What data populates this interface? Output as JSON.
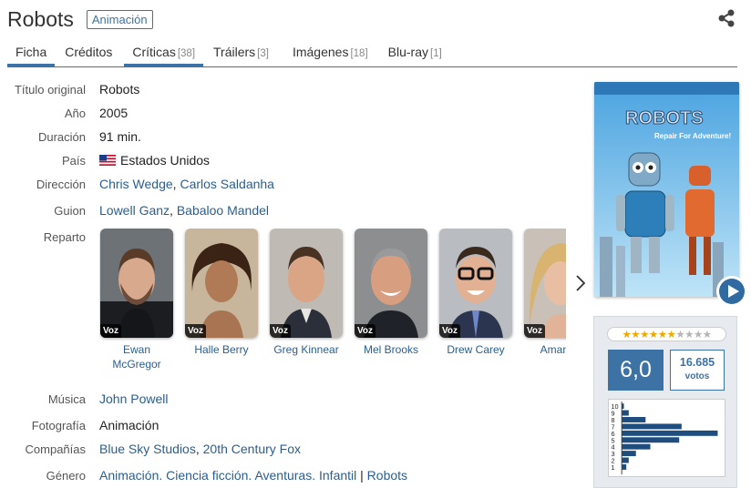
{
  "header": {
    "title": "Robots",
    "genre_badge": "Animación"
  },
  "tabs": [
    {
      "label": "Ficha",
      "count": ""
    },
    {
      "label": "Créditos",
      "count": ""
    },
    {
      "label": "Críticas",
      "count": "[38]"
    },
    {
      "label": "Tráilers",
      "count": "[3]"
    },
    {
      "label": "Imágenes",
      "count": "[18]"
    },
    {
      "label": "Blu-ray",
      "count": "[1]"
    }
  ],
  "details": {
    "titulo_original": {
      "label": "Título original",
      "value": "Robots"
    },
    "anio": {
      "label": "Año",
      "value": "2005"
    },
    "duracion": {
      "label": "Duración",
      "value": "91 min."
    },
    "pais": {
      "label": "País",
      "value": "Estados Unidos"
    },
    "direccion": {
      "label": "Dirección",
      "names": [
        "Chris Wedge",
        "Carlos Saldanha"
      ]
    },
    "guion": {
      "label": "Guion",
      "names": [
        "Lowell Ganz",
        "Babaloo Mandel"
      ]
    },
    "reparto": {
      "label": "Reparto"
    },
    "musica": {
      "label": "Música",
      "value": "John Powell"
    },
    "fotografia": {
      "label": "Fotografía",
      "value": "Animación"
    },
    "companias": {
      "label": "Compañías",
      "names": [
        "Blue Sky Studios",
        "20th Century Fox"
      ]
    },
    "genero": {
      "label": "Género",
      "names": [
        "Animación.",
        "Ciencia ficción.",
        "Aventuras.",
        "Infantil"
      ],
      "separator": "|",
      "topic": "Robots"
    }
  },
  "cast": [
    {
      "name": "Ewan McGregor",
      "badge": "Voz"
    },
    {
      "name": "Halle Berry",
      "badge": "Voz"
    },
    {
      "name": "Greg Kinnear",
      "badge": "Voz"
    },
    {
      "name": "Mel Brooks",
      "badge": "Voz"
    },
    {
      "name": "Drew Carey",
      "badge": "Voz"
    },
    {
      "name": "Amanda",
      "badge": "Voz"
    }
  ],
  "poster": {
    "title_text": "ROBOTS",
    "tagline": "Repair For Adventure!"
  },
  "rating": {
    "stars_filled": 6,
    "stars_total": 10,
    "average": "6,0",
    "votes_count": "16.685",
    "votes_label": "votos",
    "histogram_labels": [
      "10",
      "9",
      "8",
      "7",
      "6",
      "5",
      "4",
      "3",
      "2",
      "1"
    ],
    "histogram_values": [
      1,
      3,
      10,
      25,
      40,
      24,
      12,
      6,
      3,
      2
    ]
  },
  "colors": {
    "accent": "#3d72a4",
    "link": "#2b5e8f",
    "star": "#f0a800"
  }
}
